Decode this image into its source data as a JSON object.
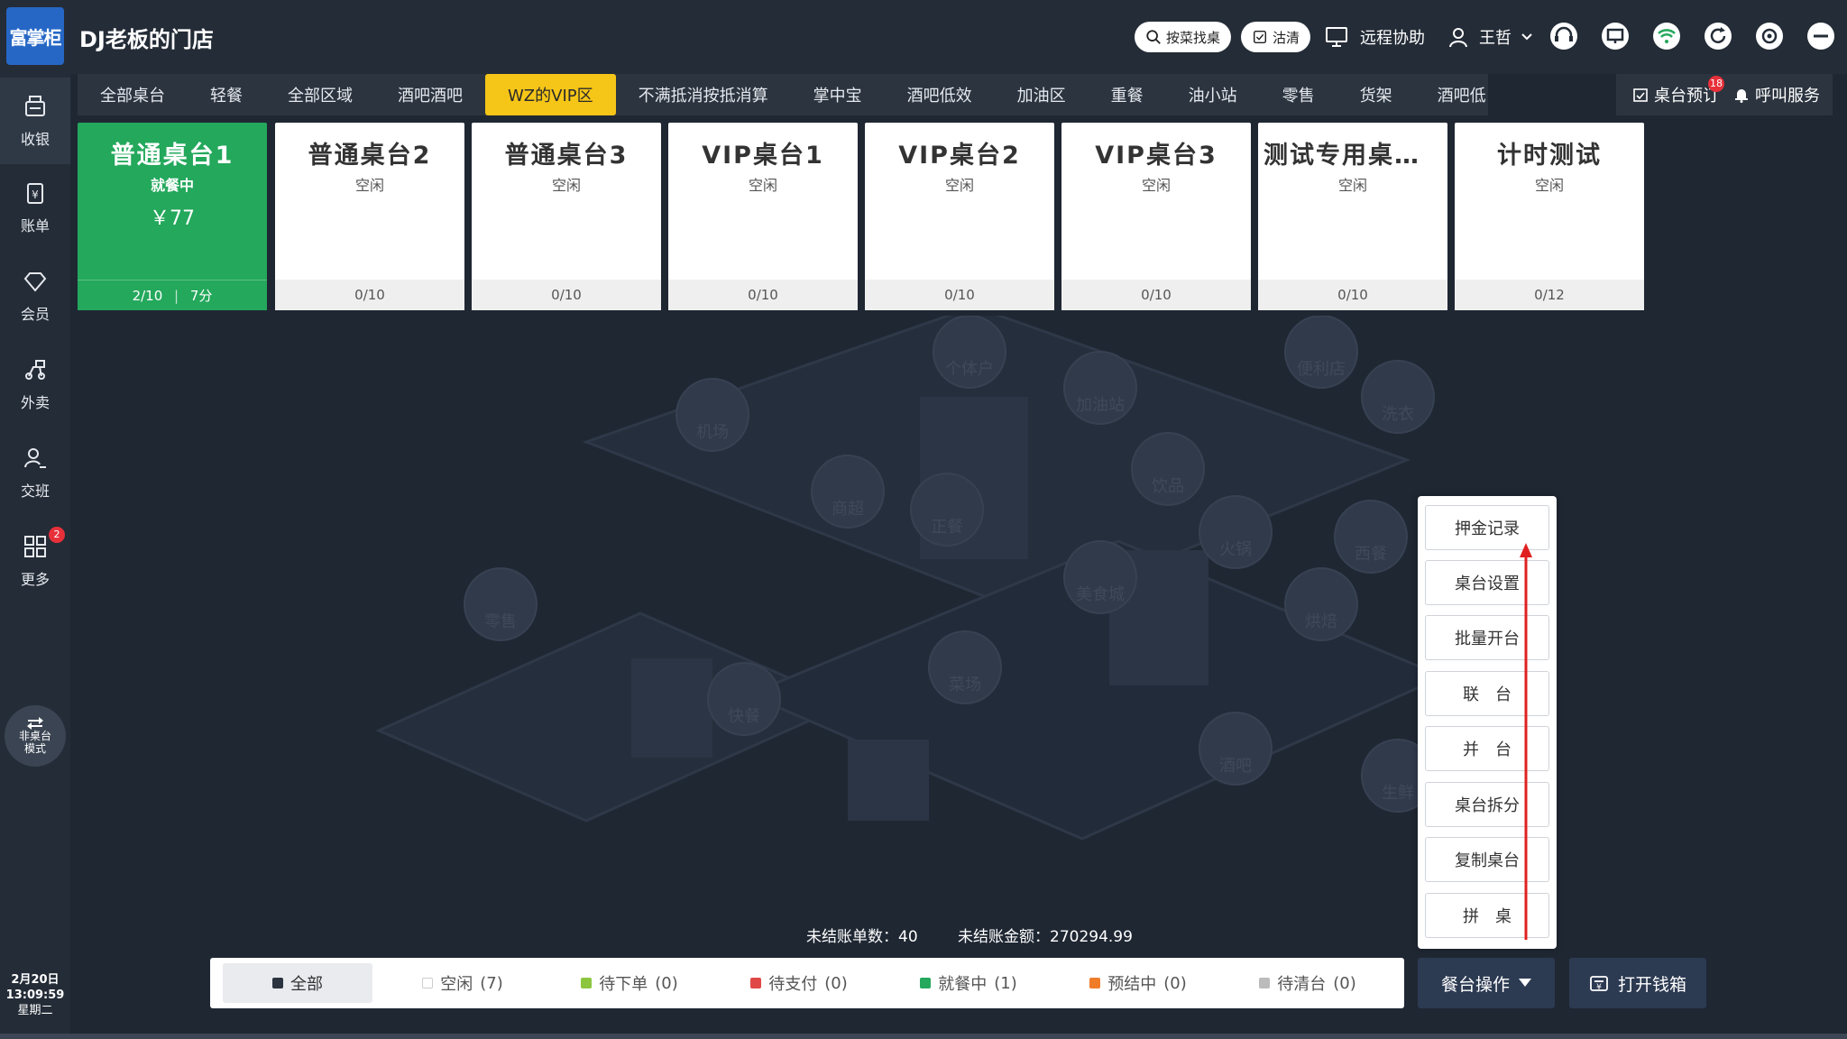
{
  "header": {
    "logo_text": "富掌柜",
    "store_name": "DJ老板的门店",
    "search_dish_label": "按菜找桌",
    "clear_label": "沽清",
    "remote_label": "远程协助",
    "user_name": "王哲"
  },
  "sidebar": {
    "items": [
      {
        "label": "收银",
        "icon": "cashier-icon"
      },
      {
        "label": "账单",
        "icon": "bill-icon"
      },
      {
        "label": "会员",
        "icon": "member-icon"
      },
      {
        "label": "外卖",
        "icon": "delivery-icon"
      },
      {
        "label": "交班",
        "icon": "shift-icon"
      },
      {
        "label": "更多",
        "icon": "grid-icon",
        "badge": "2"
      }
    ],
    "mode_button": [
      "非桌台",
      "模式"
    ],
    "date": "2月20日",
    "time": "13:09:59",
    "weekday": "星期二"
  },
  "tabs": [
    "全部桌台",
    "轻餐",
    "全部区域",
    "酒吧酒吧",
    "WZ的VIP区",
    "不满抵消按抵消算",
    "掌中宝",
    "酒吧低效",
    "加油区",
    "重餐",
    "油小站",
    "零售",
    "货架",
    "酒吧低"
  ],
  "active_tab": "WZ的VIP区",
  "tab_right": {
    "reserve_label": "桌台预订",
    "reserve_badge": "18",
    "call_label": "呼叫服务"
  },
  "tables": [
    {
      "name": "普通桌台1",
      "status": "就餐中",
      "amount": "￥77",
      "guests": "2/10",
      "duration": "7分"
    },
    {
      "name": "普通桌台2",
      "status": "空闲",
      "foot": "0/10"
    },
    {
      "name": "普通桌台3",
      "status": "空闲",
      "foot": "0/10"
    },
    {
      "name": "VIP桌台1",
      "status": "空闲",
      "foot": "0/10"
    },
    {
      "name": "VIP桌台2",
      "status": "空闲",
      "foot": "0/10"
    },
    {
      "name": "VIP桌台3",
      "status": "空闲",
      "foot": "0/10"
    },
    {
      "name": "测试专用桌台…",
      "status": "空闲",
      "foot": "0/10"
    },
    {
      "name": "计时测试",
      "status": "空闲",
      "foot": "0/12"
    }
  ],
  "illustration_labels": [
    "个体户",
    "便利店",
    "加油站",
    "洗衣",
    "机场",
    "商超",
    "正餐",
    "饮品",
    "火锅",
    "西餐",
    "零售",
    "美食城",
    "烘焙",
    "菜场",
    "快餐",
    "酒吧",
    "生鲜"
  ],
  "popup_menu": [
    "押金记录",
    "桌台设置",
    "批量开台",
    "联　台",
    "并　台",
    "桌台拆分",
    "复制桌台",
    "拼　桌"
  ],
  "stats": {
    "unsettled_count_label": "未结账单数：",
    "unsettled_count": "40",
    "unsettled_amount_label": "未结账金额：",
    "unsettled_amount": "270294.99"
  },
  "filters": [
    {
      "label": "全部",
      "count": "",
      "color": "#2b3440"
    },
    {
      "label": "空闲",
      "count": "(7)",
      "color": "#ffffff"
    },
    {
      "label": "待下单",
      "count": "(0)",
      "color": "#8cc63f"
    },
    {
      "label": "待支付",
      "count": "(0)",
      "color": "#e04848"
    },
    {
      "label": "就餐中",
      "count": "(1)",
      "color": "#24a85c"
    },
    {
      "label": "预结中",
      "count": "(0)",
      "color": "#f07c2a"
    },
    {
      "label": "待清台",
      "count": "(0)",
      "color": "#bbbbbb"
    }
  ],
  "table_ops_label": "餐台操作",
  "open_cashbox_label": "打开钱箱",
  "colors": {
    "accent_yellow": "#f5c518",
    "occupied_green": "#24a85c",
    "badge_red": "#e8303a"
  }
}
